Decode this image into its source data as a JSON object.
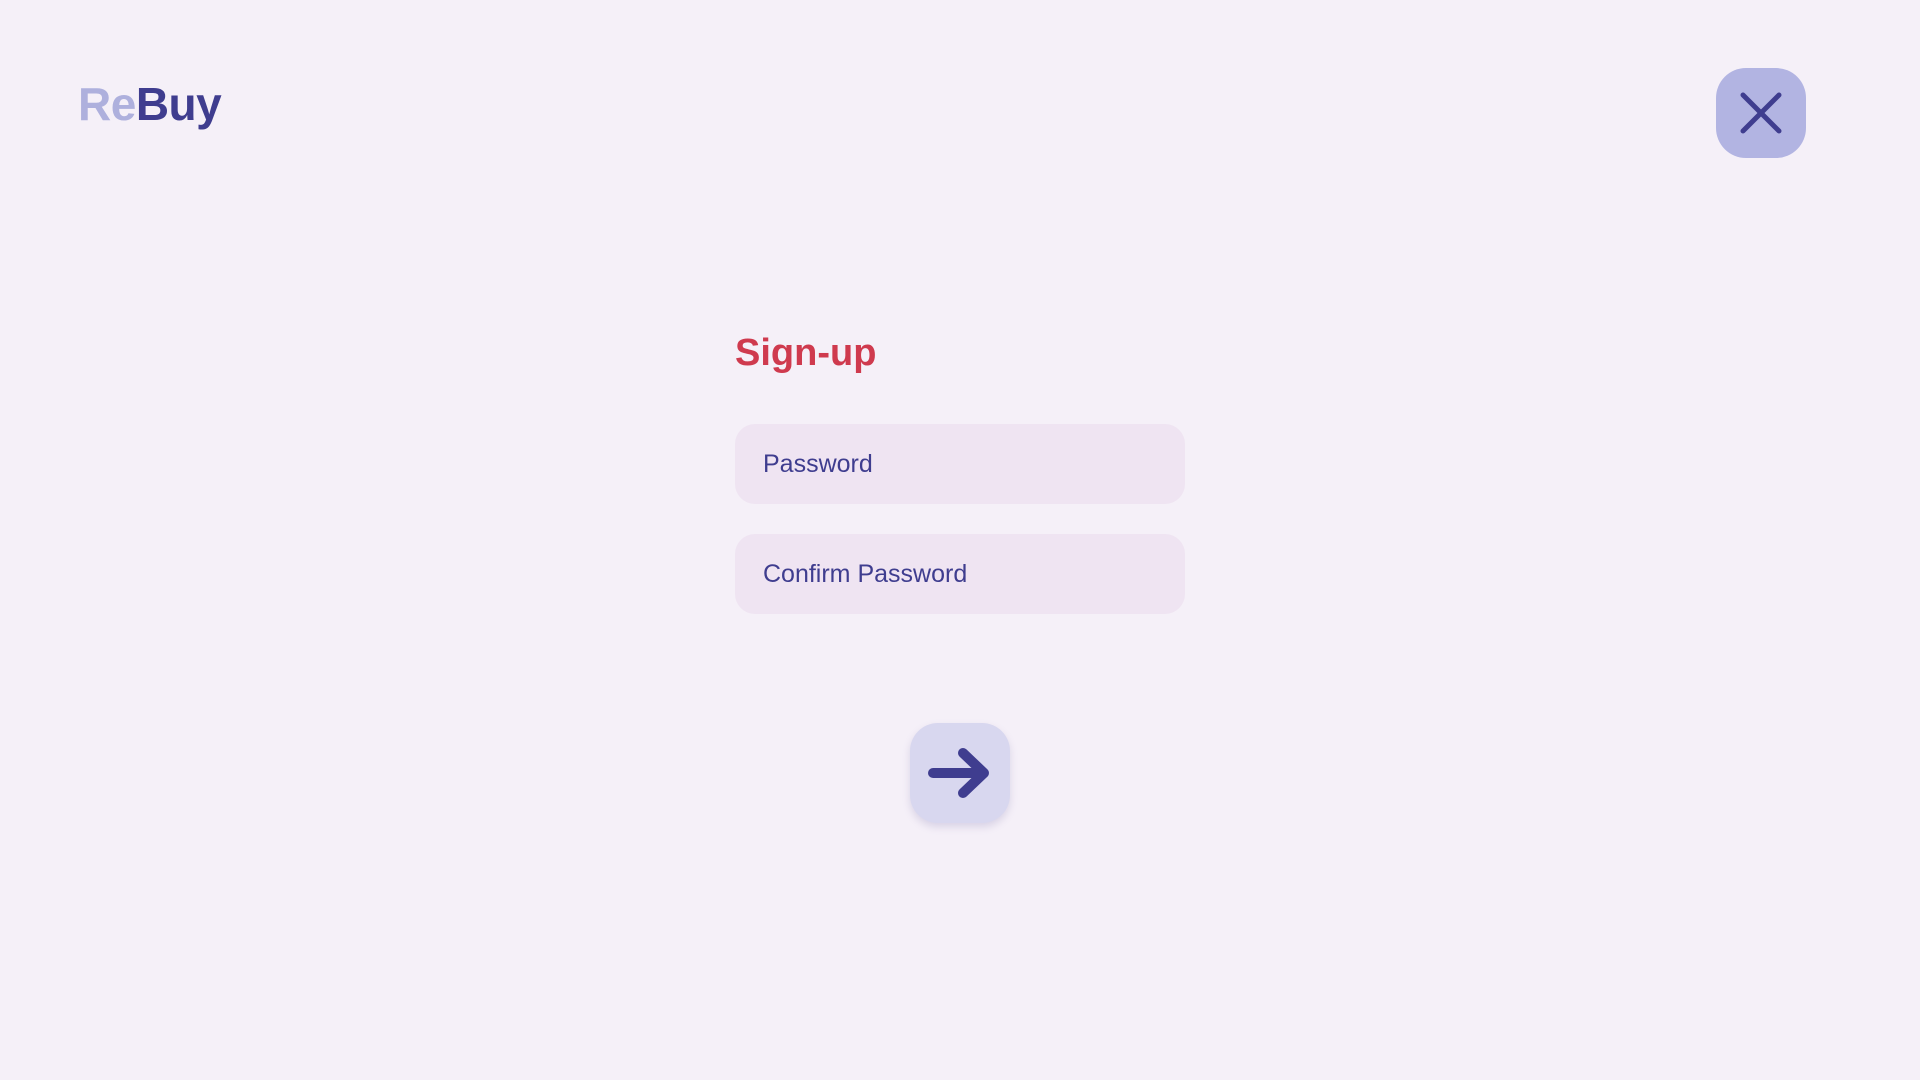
{
  "brand": {
    "logo_part1": "Re",
    "logo_part2": "Buy",
    "colors": {
      "logo_light": "#aeb0dd",
      "logo_dark": "#3f3d8f",
      "accent_title": "#cf3a4e",
      "background": "#f5f0f8",
      "field_bg": "#efe4f2",
      "close_button_bg": "#b2b4e2",
      "submit_button_bg": "#d8d7ef"
    }
  },
  "header": {
    "close_icon": "close-icon"
  },
  "form": {
    "title": "Sign-up",
    "password_placeholder": "Password",
    "confirm_password_placeholder": "Confirm Password",
    "submit_icon": "arrow-right-icon"
  }
}
